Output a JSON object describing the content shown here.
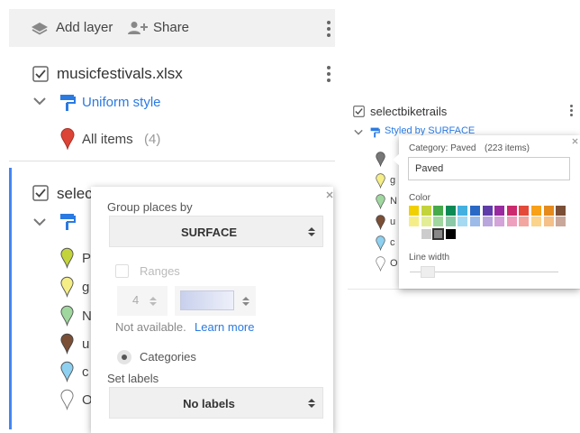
{
  "toolbar": {
    "add_layer": "Add layer",
    "share": "Share"
  },
  "layer1": {
    "title": "musicfestivals.xlsx",
    "style": "Uniform style",
    "all_items": "All items",
    "count": "(4)"
  },
  "layer2": {
    "title": "selec",
    "items": [
      "P",
      "g",
      "N",
      "u",
      "c",
      "O"
    ]
  },
  "group_popup": {
    "group_label": "Group places by",
    "group_value": "SURFACE",
    "ranges_label": "Ranges",
    "ranges_count": "4",
    "not_available": "Not available.",
    "learn_more": "Learn more",
    "categories_label": "Categories",
    "set_labels": "Set labels",
    "labels_value": "No labels"
  },
  "right_panel": {
    "layer_title": "selectbiketrails",
    "styled_by": "Styled by SURFACE",
    "items": [
      "g",
      "N",
      "u",
      "c",
      "O"
    ]
  },
  "color_popup": {
    "category_line": "Category: Paved",
    "count": "(223 items)",
    "name_value": "Paved",
    "color_label": "Color",
    "line_width_label": "Line width"
  },
  "colors": {
    "row1": [
      "#f0d000",
      "#c3d33c",
      "#46a94a",
      "#0b8a55",
      "#43b0e0",
      "#2a68c6",
      "#5f3da8",
      "#992aa0",
      "#cc2a6e",
      "#e34a3a",
      "#f7a018",
      "#e58a1c",
      "#7a4f36"
    ],
    "row2": [
      "#f5ee87",
      "#e3ed95",
      "#9fd79f",
      "#8bc9a9",
      "#a6daf3",
      "#9cbbe8",
      "#b9a6dd",
      "#d4a3d9",
      "#ee9fbd",
      "#f3a6a0",
      "#fbd38b",
      "#f6c089",
      "#c9a89b"
    ],
    "row3": [
      "#ffffff",
      "#cccccc",
      "#888888",
      "#000000"
    ],
    "accent": "#2a7ae2"
  }
}
